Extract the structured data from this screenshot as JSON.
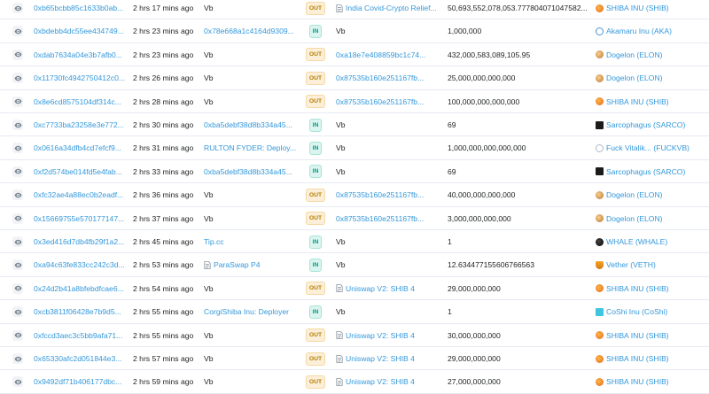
{
  "colors": {
    "link": "#3498db",
    "out_bg": "#fcefd9",
    "out_fg": "#b47d00",
    "in_bg": "#daf4ef",
    "in_fg": "#00a186",
    "border": "#e7eaf3"
  },
  "rows": [
    {
      "hash": "0xb65bcbb85c1633b0ab...",
      "age": "2 hrs 17 mins ago",
      "from": "Vb",
      "from_link": false,
      "dir": "OUT",
      "to": "India Covid-Crypto Relief...",
      "to_link": true,
      "to_contract": true,
      "qty": "50,693,552,078,053.777804071047582...",
      "token": "SHIBA INU (SHIB)",
      "token_icon": "shiba-icon"
    },
    {
      "hash": "0xbdebb4dc55ee434749...",
      "age": "2 hrs 23 mins ago",
      "from": "0x78e668a1c4164d9309...",
      "from_link": true,
      "dir": "IN",
      "to": "Vb",
      "to_link": false,
      "to_contract": false,
      "qty": "1,000,000",
      "token": "Akamaru Inu (AKA)",
      "token_icon": "akamaru-icon"
    },
    {
      "hash": "0xdab7634a04e3b7afb0...",
      "age": "2 hrs 23 mins ago",
      "from": "Vb",
      "from_link": false,
      "dir": "OUT",
      "to": "0xa18e7e408859bc1c74...",
      "to_link": true,
      "to_contract": false,
      "qty": "432,000,583,089,105.95",
      "token": "Dogelon (ELON)",
      "token_icon": "dogelon-icon"
    },
    {
      "hash": "0x11730fc4942750412c0...",
      "age": "2 hrs 26 mins ago",
      "from": "Vb",
      "from_link": false,
      "dir": "OUT",
      "to": "0x87535b160e251167fb...",
      "to_link": true,
      "to_contract": false,
      "qty": "25,000,000,000,000",
      "token": "Dogelon (ELON)",
      "token_icon": "dogelon-icon"
    },
    {
      "hash": "0x8e6cd8575104df314c...",
      "age": "2 hrs 28 mins ago",
      "from": "Vb",
      "from_link": false,
      "dir": "OUT",
      "to": "0x87535b160e251167fb...",
      "to_link": true,
      "to_contract": false,
      "qty": "100,000,000,000,000",
      "token": "SHIBA INU (SHIB)",
      "token_icon": "shiba-icon"
    },
    {
      "hash": "0xc7733ba23258e3e772...",
      "age": "2 hrs 30 mins ago",
      "from": "0xba5debf38d8b334a45...",
      "from_link": true,
      "dir": "IN",
      "to": "Vb",
      "to_link": false,
      "to_contract": false,
      "qty": "69",
      "token": "Sarcophagus (SARCO)",
      "token_icon": "sarco-icon"
    },
    {
      "hash": "0x0616a34dfb4cd7efcf9...",
      "age": "2 hrs 31 mins ago",
      "from": "RULTON FYDER: Deploy...",
      "from_link": true,
      "dir": "IN",
      "to": "Vb",
      "to_link": false,
      "to_contract": false,
      "qty": "1,000,000,000,000,000",
      "token": "Fuck Vitalik... (FUCKVB)",
      "token_icon": "fuckvb-icon"
    },
    {
      "hash": "0xf2d574be014fd5e4fab...",
      "age": "2 hrs 33 mins ago",
      "from": "0xba5debf38d8b334a45...",
      "from_link": true,
      "dir": "IN",
      "to": "Vb",
      "to_link": false,
      "to_contract": false,
      "qty": "69",
      "token": "Sarcophagus (SARCO)",
      "token_icon": "sarco-icon"
    },
    {
      "hash": "0xfc32ae4a88ec0b2eadf...",
      "age": "2 hrs 36 mins ago",
      "from": "Vb",
      "from_link": false,
      "dir": "OUT",
      "to": "0x87535b160e251167fb...",
      "to_link": true,
      "to_contract": false,
      "qty": "40,000,000,000,000",
      "token": "Dogelon (ELON)",
      "token_icon": "dogelon-icon"
    },
    {
      "hash": "0x15669755e570177147...",
      "age": "2 hrs 37 mins ago",
      "from": "Vb",
      "from_link": false,
      "dir": "OUT",
      "to": "0x87535b160e251167fb...",
      "to_link": true,
      "to_contract": false,
      "qty": "3,000,000,000,000",
      "token": "Dogelon (ELON)",
      "token_icon": "dogelon-icon"
    },
    {
      "hash": "0x3ed416d7db4fb29f1a2...",
      "age": "2 hrs 45 mins ago",
      "from": "Tip.cc",
      "from_link": true,
      "dir": "IN",
      "to": "Vb",
      "to_link": false,
      "to_contract": false,
      "qty": "1",
      "token": "WHALE (WHALE)",
      "token_icon": "whale-icon"
    },
    {
      "hash": "0xa94c63fe833cc242c3d...",
      "age": "2 hrs 53 mins ago",
      "from": "ParaSwap P4",
      "from_link": true,
      "from_contract": true,
      "dir": "IN",
      "to": "Vb",
      "to_link": false,
      "to_contract": false,
      "qty": "12.634477155606766563",
      "token": "Vether (VETH)",
      "token_icon": "vether-icon"
    },
    {
      "hash": "0x24d2b41a8bfebdfcae6...",
      "age": "2 hrs 54 mins ago",
      "from": "Vb",
      "from_link": false,
      "dir": "OUT",
      "to": "Uniswap V2: SHIB 4",
      "to_link": true,
      "to_contract": true,
      "qty": "29,000,000,000",
      "token": "SHIBA INU (SHIB)",
      "token_icon": "shiba-icon"
    },
    {
      "hash": "0xcb3811f06428e7b9d5...",
      "age": "2 hrs 55 mins ago",
      "from": "CorgiShiba Inu: Deployer",
      "from_link": true,
      "dir": "IN",
      "to": "Vb",
      "to_link": false,
      "to_contract": false,
      "qty": "1",
      "token": "CoShi Inu (CoShi)",
      "token_icon": "coshi-icon"
    },
    {
      "hash": "0xfccd3aec3c5bb9afa71...",
      "age": "2 hrs 55 mins ago",
      "from": "Vb",
      "from_link": false,
      "dir": "OUT",
      "to": "Uniswap V2: SHIB 4",
      "to_link": true,
      "to_contract": true,
      "qty": "30,000,000,000",
      "token": "SHIBA INU (SHIB)",
      "token_icon": "shiba-icon"
    },
    {
      "hash": "0x65330afc2d051844e3...",
      "age": "2 hrs 57 mins ago",
      "from": "Vb",
      "from_link": false,
      "dir": "OUT",
      "to": "Uniswap V2: SHIB 4",
      "to_link": true,
      "to_contract": true,
      "qty": "29,000,000,000",
      "token": "SHIBA INU (SHIB)",
      "token_icon": "shiba-icon"
    },
    {
      "hash": "0x9492df71b406177dbc...",
      "age": "2 hrs 59 mins ago",
      "from": "Vb",
      "from_link": false,
      "dir": "OUT",
      "to": "Uniswap V2: SHIB 4",
      "to_link": true,
      "to_contract": true,
      "qty": "27,000,000,000",
      "token": "SHIBA INU (SHIB)",
      "token_icon": "shiba-icon"
    }
  ]
}
